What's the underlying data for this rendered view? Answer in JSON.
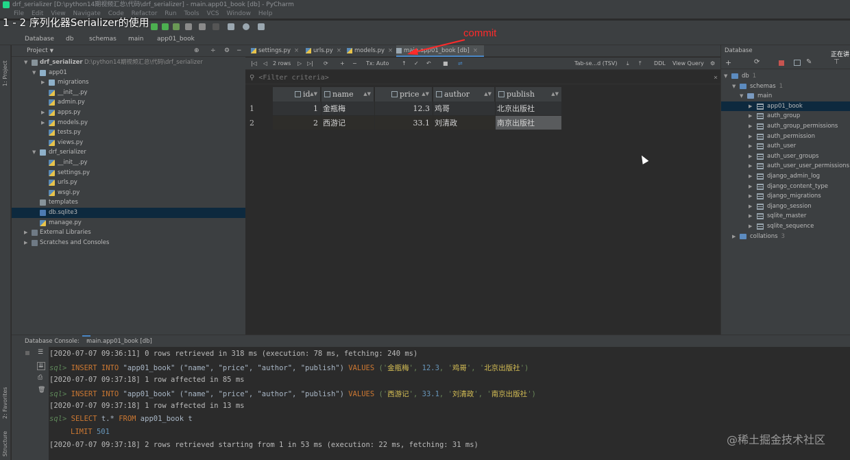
{
  "window": {
    "title": "drf_serializer [D:\\python14期视频汇总\\代码\\drf_serializer] - main.app01_book [db] - PyCharm",
    "menu": [
      "File",
      "Edit",
      "View",
      "Navigate",
      "Code",
      "Refactor",
      "Run",
      "Tools",
      "VCS",
      "Window",
      "Help"
    ],
    "overlay_title": "1 - 2 序列化器Serializer的使用"
  },
  "navbar": {
    "items": [
      "Database",
      "db",
      "schemas",
      "main",
      "app01_book"
    ]
  },
  "left_stripe": {
    "project_label": "1: Project",
    "favorites_label": "2: Favorites",
    "structure_label": "Structure"
  },
  "project": {
    "header": "Project",
    "tree": [
      {
        "label": "drf_serializer",
        "path": "D:\\python14期视频汇总\\代码\\drf_serializer"
      },
      {
        "label": "app01"
      },
      {
        "label": "migrations"
      },
      {
        "label": "__init__.py"
      },
      {
        "label": "admin.py"
      },
      {
        "label": "apps.py"
      },
      {
        "label": "models.py"
      },
      {
        "label": "tests.py"
      },
      {
        "label": "views.py"
      },
      {
        "label": "drf_serializer"
      },
      {
        "label": "__init__.py"
      },
      {
        "label": "settings.py"
      },
      {
        "label": "urls.py"
      },
      {
        "label": "wsgi.py"
      },
      {
        "label": "templates"
      },
      {
        "label": "db.sqlite3"
      },
      {
        "label": "manage.py"
      },
      {
        "label": "External Libraries"
      },
      {
        "label": "Scratches and Consoles"
      }
    ]
  },
  "editor_tabs": [
    "settings.py",
    "urls.py",
    "models.py",
    "main.app01_book [db]"
  ],
  "grid_toolbar": {
    "rows_label": "2 rows",
    "tx_label": "Tx: Auto",
    "format_label": "Tab-se...d (TSV)",
    "ddl_label": "DDL",
    "view_query_label": "View Query"
  },
  "filter": {
    "placeholder": "<Filter criteria>"
  },
  "table": {
    "columns": [
      "id",
      "name",
      "price",
      "author",
      "publish"
    ],
    "rows": [
      {
        "rownum": "1",
        "id": "1",
        "name": "金瓶梅",
        "price": "12.3",
        "author": "鸡哥",
        "publish": "北京出版社"
      },
      {
        "rownum": "2",
        "id": "2",
        "name": "西游记",
        "price": "33.1",
        "author": "刘清政",
        "publish": "南京出版社"
      }
    ]
  },
  "annotation": {
    "label": "commit",
    "color": "#ff2a2a"
  },
  "database_panel": {
    "header": "Database",
    "busy_label": "正在讲",
    "db_name": "db",
    "db_count": "1",
    "schemas_label": "schemas",
    "schemas_count": "1",
    "main_label": "main",
    "tables": [
      "app01_book",
      "auth_group",
      "auth_group_permissions",
      "auth_permission",
      "auth_user",
      "auth_user_groups",
      "auth_user_user_permissions",
      "django_admin_log",
      "django_content_type",
      "django_migrations",
      "django_session",
      "sqlite_master",
      "sqlite_sequence"
    ],
    "collations_label": "collations",
    "collations_count": "3"
  },
  "console": {
    "tabs": [
      "Database Console:",
      "main.app01_book [db]"
    ],
    "prompt": "sql>",
    "log1": "[2020-07-07 09:36:11] 0 rows retrieved in 318 ms (execution: 78 ms, fetching: 240 ms)",
    "insert_kw": "INSERT INTO",
    "table_name": "\"app01_book\"",
    "cols": "(\"name\", \"price\", \"author\", \"publish\")",
    "values_kw": "VALUES",
    "v1_open": "('",
    "v1_name": "金瓶梅",
    "sep": "', ",
    "v1_price": "12.3",
    "sep2": ", '",
    "v1_author": "鸡哥",
    "sep3": "', '",
    "v1_publish": "北京出版社",
    "close": "')",
    "log2": "[2020-07-07 09:37:18] 1 row affected in 85 ms",
    "v2_name": "西游记",
    "v2_price": "33.1",
    "v2_author": "刘清政",
    "v2_publish": "南京出版社",
    "log3": "[2020-07-07 09:37:18] 1 row affected in 13 ms",
    "select_kw": "SELECT",
    "select_rest": "t.* ",
    "from_kw": "FROM",
    "from_rest": " app01_book t",
    "limit_kw": "LIMIT",
    "limit_val": "501",
    "log4": "[2020-07-07 09:37:18] 2 rows retrieved starting from 1 in 53 ms (execution: 22 ms, fetching: 31 ms)"
  },
  "watermark": "@稀土掘金技术社区"
}
